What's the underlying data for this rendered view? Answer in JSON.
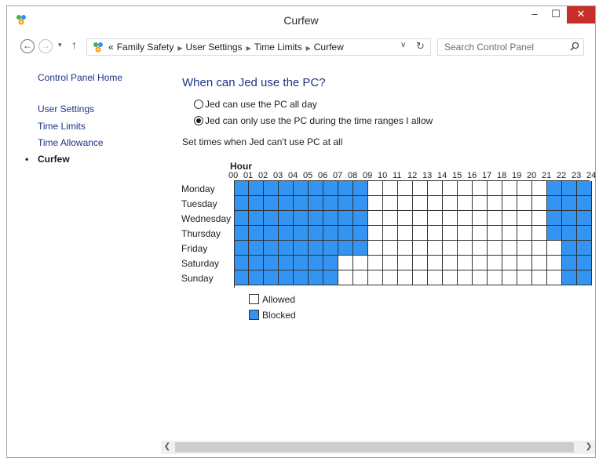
{
  "window": {
    "title": "Curfew",
    "minimize_glyph": "–",
    "maximize_glyph": "☐",
    "close_glyph": "✕"
  },
  "navbar": {
    "back_glyph": "←",
    "forward_glyph": "→",
    "recent_glyph": "▾",
    "up_glyph": "↑",
    "breadcrumb_prefix": "«",
    "breadcrumbs": [
      "Family Safety",
      "User Settings",
      "Time Limits",
      "Curfew"
    ],
    "breadcrumb_separator": "▶",
    "dropdown_glyph": "∨",
    "refresh_glyph": "↻",
    "search_placeholder": "Search Control Panel"
  },
  "sidebar": {
    "home": "Control Panel Home",
    "items": [
      {
        "label": "User Settings",
        "current": false
      },
      {
        "label": "Time Limits",
        "current": false
      },
      {
        "label": "Time Allowance",
        "current": false
      },
      {
        "label": "Curfew",
        "current": true
      }
    ],
    "bullet": "•"
  },
  "main": {
    "title": "When can Jed use the PC?",
    "options": [
      {
        "label": "Jed can use the PC all day",
        "checked": false
      },
      {
        "label": "Jed can only use the PC during the time ranges I allow",
        "checked": true
      }
    ],
    "instruction": "Set times when Jed can't use PC at all"
  },
  "curfew": {
    "hour_title": "Hour",
    "hours": [
      "00",
      "01",
      "02",
      "03",
      "04",
      "05",
      "06",
      "07",
      "08",
      "09",
      "10",
      "11",
      "12",
      "13",
      "14",
      "15",
      "16",
      "17",
      "18",
      "19",
      "20",
      "21",
      "22",
      "23",
      "24"
    ],
    "days": [
      "Monday",
      "Tuesday",
      "Wednesday",
      "Thursday",
      "Friday",
      "Saturday",
      "Sunday"
    ],
    "blocked": [
      [
        1,
        1,
        1,
        1,
        1,
        1,
        1,
        1,
        1,
        0,
        0,
        0,
        0,
        0,
        0,
        0,
        0,
        0,
        0,
        0,
        0,
        1,
        1,
        1
      ],
      [
        1,
        1,
        1,
        1,
        1,
        1,
        1,
        1,
        1,
        0,
        0,
        0,
        0,
        0,
        0,
        0,
        0,
        0,
        0,
        0,
        0,
        1,
        1,
        1
      ],
      [
        1,
        1,
        1,
        1,
        1,
        1,
        1,
        1,
        1,
        0,
        0,
        0,
        0,
        0,
        0,
        0,
        0,
        0,
        0,
        0,
        0,
        1,
        1,
        1
      ],
      [
        1,
        1,
        1,
        1,
        1,
        1,
        1,
        1,
        1,
        0,
        0,
        0,
        0,
        0,
        0,
        0,
        0,
        0,
        0,
        0,
        0,
        1,
        1,
        1
      ],
      [
        1,
        1,
        1,
        1,
        1,
        1,
        1,
        1,
        1,
        0,
        0,
        0,
        0,
        0,
        0,
        0,
        0,
        0,
        0,
        0,
        0,
        0,
        1,
        1
      ],
      [
        1,
        1,
        1,
        1,
        1,
        1,
        1,
        0,
        0,
        0,
        0,
        0,
        0,
        0,
        0,
        0,
        0,
        0,
        0,
        0,
        0,
        0,
        1,
        1
      ],
      [
        1,
        1,
        1,
        1,
        1,
        1,
        1,
        0,
        0,
        0,
        0,
        0,
        0,
        0,
        0,
        0,
        0,
        0,
        0,
        0,
        0,
        0,
        1,
        1
      ]
    ],
    "legend": {
      "allowed": "Allowed",
      "blocked": "Blocked"
    },
    "colors": {
      "blocked": "#3395f1",
      "allowed": "#ffffff",
      "link": "#1e3287"
    }
  },
  "scrollbar": {
    "left_glyph": "❮",
    "right_glyph": "❯"
  }
}
